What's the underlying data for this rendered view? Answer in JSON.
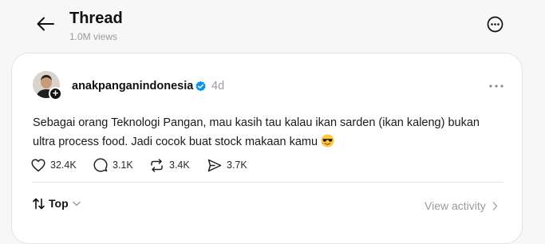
{
  "header": {
    "title": "Thread",
    "views": "1.0M views",
    "back_icon": "arrow-left-icon",
    "more_icon": "more-circle-icon"
  },
  "post": {
    "username": "anakpanganindonesia",
    "verified": true,
    "time": "4d",
    "text_line1": "Sebagai orang Teknologi Pangan, mau kasih tau kalau ikan sarden (ikan kaleng) bukan",
    "text_line2": "ultra process food. Jadi cocok buat stock makaan kamu",
    "emoji": "smiling-face-with-sunglasses",
    "actions": {
      "likes": "32.4K",
      "replies": "3.1K",
      "reposts": "3.4K",
      "shares": "3.7K"
    }
  },
  "footer": {
    "sort_label": "Top",
    "view_activity": "View activity"
  },
  "colors": {
    "background": "#f7f7f7",
    "card": "#ffffff",
    "verified": "#0095f6",
    "muted": "#9a9a9a"
  }
}
